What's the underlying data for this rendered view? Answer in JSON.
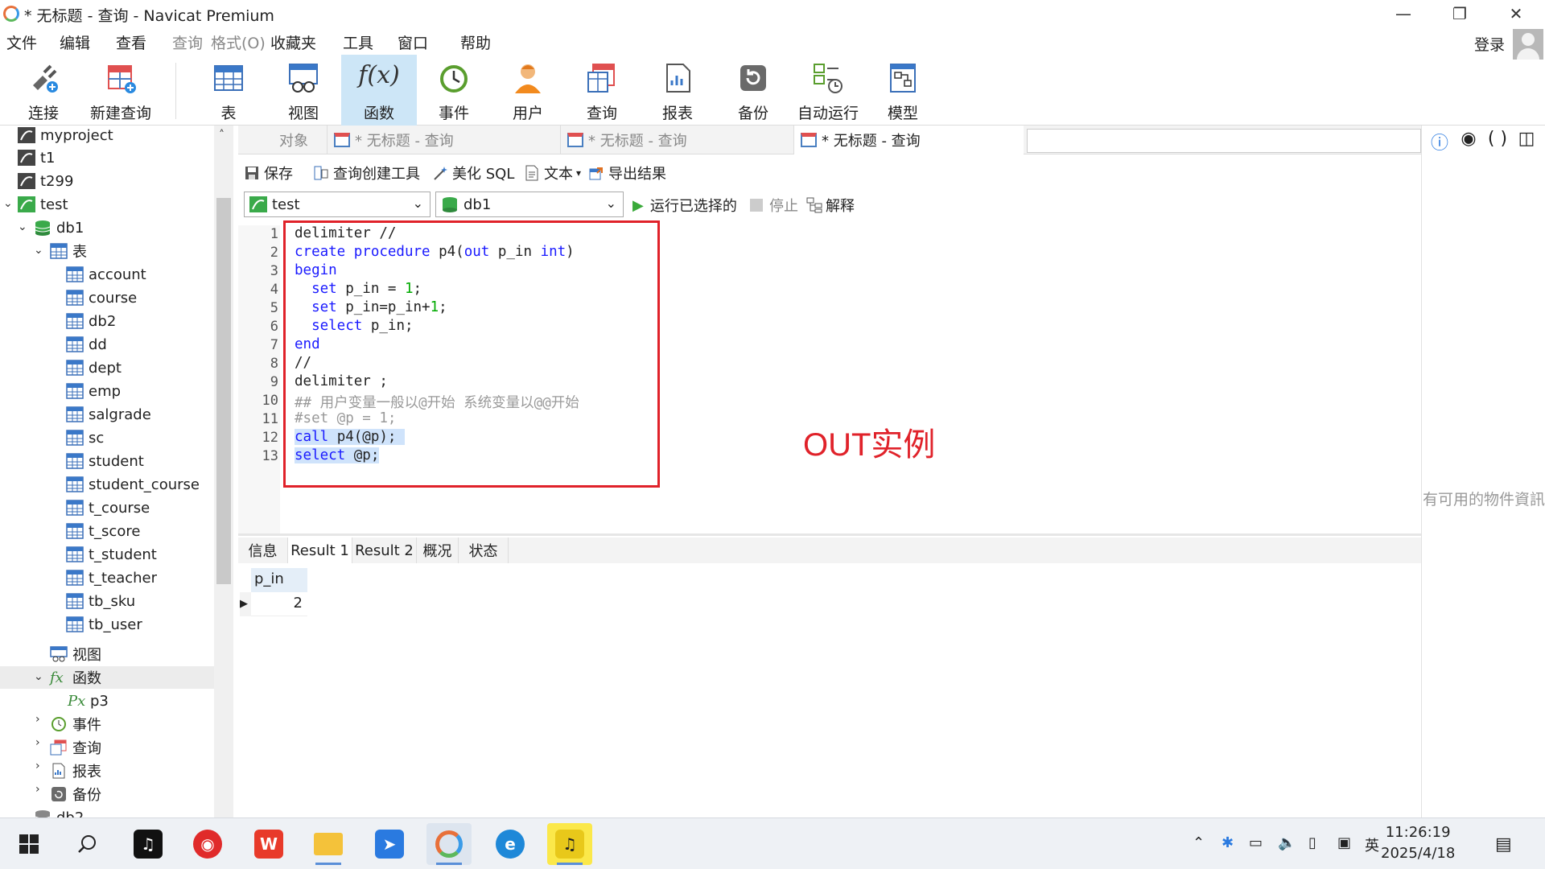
{
  "window": {
    "title": "* 无标题 - 查询 - Navicat Premium",
    "controls": [
      "minimize-icon",
      "restore-icon",
      "close-icon"
    ]
  },
  "menu": {
    "items": [
      {
        "label": "文件",
        "enabled": true
      },
      {
        "label": "编辑",
        "enabled": true
      },
      {
        "label": "查看",
        "enabled": true
      },
      {
        "label": "查询",
        "enabled": false
      },
      {
        "label": "格式(O)",
        "enabled": false
      },
      {
        "label": "收藏夹",
        "enabled": true
      },
      {
        "label": "工具",
        "enabled": true
      },
      {
        "label": "窗口",
        "enabled": true
      },
      {
        "label": "帮助",
        "enabled": true
      }
    ],
    "login": "登录"
  },
  "toolbar": {
    "items": [
      {
        "label": "连接",
        "icon": "connection-icon"
      },
      {
        "label": "新建查询",
        "icon": "new-query-icon"
      },
      {
        "label": "表",
        "icon": "table-icon"
      },
      {
        "label": "视图",
        "icon": "view-icon"
      },
      {
        "label": "函数",
        "icon": "function-icon",
        "active": true
      },
      {
        "label": "事件",
        "icon": "event-icon"
      },
      {
        "label": "用户",
        "icon": "user-icon"
      },
      {
        "label": "查询",
        "icon": "query-icon"
      },
      {
        "label": "报表",
        "icon": "report-icon"
      },
      {
        "label": "备份",
        "icon": "backup-icon"
      },
      {
        "label": "自动运行",
        "icon": "automation-icon"
      },
      {
        "label": "模型",
        "icon": "model-icon"
      }
    ]
  },
  "tree": {
    "connections_top": [
      "myproject",
      "t1",
      "t299"
    ],
    "connection": "test",
    "database": "db1",
    "tables_group": "表",
    "tables": [
      "account",
      "course",
      "db2",
      "dd",
      "dept",
      "emp",
      "salgrade",
      "sc",
      "student",
      "student_course",
      "t_course",
      "t_score",
      "t_student",
      "t_teacher",
      "tb_sku",
      "tb_user"
    ],
    "views_group": "视图",
    "functions_group": "函数",
    "functions": [
      "p3"
    ],
    "events_group": "事件",
    "queries_group": "查询",
    "reports_group": "报表",
    "backups_group": "备份",
    "other_db": "db2"
  },
  "tabs": {
    "objects": "对象",
    "items": [
      "* 无标题 - 查询",
      "* 无标题 - 查询",
      "* 无标题 - 查询"
    ],
    "active_index": 2
  },
  "editor_toolbar": {
    "save": "保存",
    "query_builder": "查询创建工具",
    "beautify": "美化 SQL",
    "text": "文本",
    "export": "导出结果",
    "connection_value": "test",
    "database_value": "db1",
    "run_selected": "运行已选择的",
    "stop": "停止",
    "explain": "解释"
  },
  "code": {
    "line_numbers": [
      "1",
      "2",
      "3",
      "4",
      "5",
      "6",
      "7",
      "8",
      "9",
      "10",
      "11",
      "12",
      "13"
    ],
    "annotation": "OUT实例"
  },
  "right_panel": {
    "message": "有可用的物件資訊"
  },
  "results": {
    "tabs": [
      "信息",
      "Result 1",
      "Result 2",
      "概况",
      "状态"
    ],
    "active_tab": "Result 1",
    "columns": [
      "p_in"
    ],
    "rows": [
      [
        "2"
      ]
    ]
  },
  "taskbar": {
    "time": "11:26:19",
    "date": "2025/4/18",
    "ime": "英"
  }
}
